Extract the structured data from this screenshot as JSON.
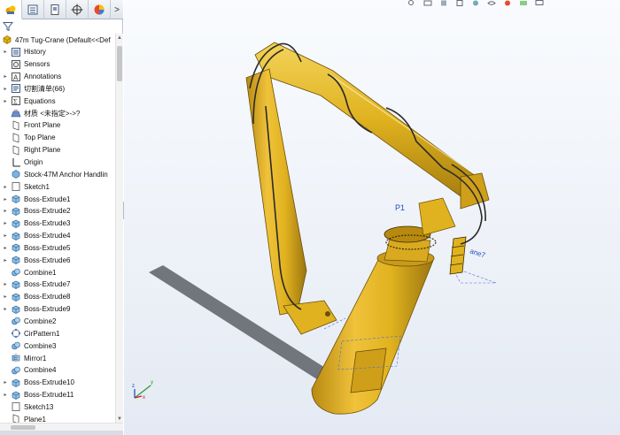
{
  "panel": {
    "tabs": [
      {
        "icon": "feature-manager-icon"
      },
      {
        "icon": "property-manager-icon"
      },
      {
        "icon": "configuration-manager-icon"
      },
      {
        "icon": "dimxpert-icon"
      },
      {
        "icon": "display-manager-icon"
      }
    ],
    "more_tabs": ">",
    "root_label": "47m Tug-Crane  (Default<<Def"
  },
  "tree": [
    {
      "label": "History",
      "icon": "history-icon",
      "expandable": true
    },
    {
      "label": "Sensors",
      "icon": "sensors-icon",
      "expandable": false
    },
    {
      "label": "Annotations",
      "icon": "annotations-icon",
      "expandable": true
    },
    {
      "label": "切割清单(66)",
      "icon": "cut-list-icon",
      "expandable": true
    },
    {
      "label": "Equations",
      "icon": "equations-icon",
      "expandable": true
    },
    {
      "label": "材质 <未指定>->?",
      "icon": "material-icon",
      "expandable": false
    },
    {
      "label": "Front Plane",
      "icon": "plane-icon",
      "expandable": false
    },
    {
      "label": "Top Plane",
      "icon": "plane-icon",
      "expandable": false
    },
    {
      "label": "Right Plane",
      "icon": "plane-icon",
      "expandable": false
    },
    {
      "label": "Origin",
      "icon": "origin-icon",
      "expandable": false
    },
    {
      "label": "Stock-47M Anchor Handlin",
      "icon": "stock-part-icon",
      "expandable": false
    },
    {
      "label": "Sketch1",
      "icon": "sketch-icon",
      "expandable": true
    },
    {
      "label": "Boss-Extrude1",
      "icon": "boss-extrude-icon",
      "expandable": true
    },
    {
      "label": "Boss-Extrude2",
      "icon": "boss-extrude-icon",
      "expandable": true
    },
    {
      "label": "Boss-Extrude3",
      "icon": "boss-extrude-icon",
      "expandable": true
    },
    {
      "label": "Boss-Extrude4",
      "icon": "boss-extrude-icon",
      "expandable": true
    },
    {
      "label": "Boss-Extrude5",
      "icon": "boss-extrude-icon",
      "expandable": true
    },
    {
      "label": "Boss-Extrude6",
      "icon": "boss-extrude-icon",
      "expandable": true
    },
    {
      "label": "Combine1",
      "icon": "combine-icon",
      "expandable": false
    },
    {
      "label": "Boss-Extrude7",
      "icon": "boss-extrude-icon",
      "expandable": true
    },
    {
      "label": "Boss-Extrude8",
      "icon": "boss-extrude-icon",
      "expandable": true
    },
    {
      "label": "Boss-Extrude9",
      "icon": "boss-extrude-icon",
      "expandable": true
    },
    {
      "label": "Combine2",
      "icon": "combine-icon",
      "expandable": false
    },
    {
      "label": "CirPattern1",
      "icon": "circular-pattern-icon",
      "expandable": false
    },
    {
      "label": "Combine3",
      "icon": "combine-icon",
      "expandable": false
    },
    {
      "label": "Mirror1",
      "icon": "mirror-icon",
      "expandable": false
    },
    {
      "label": "Combine4",
      "icon": "combine-icon",
      "expandable": false
    },
    {
      "label": "Boss-Extrude10",
      "icon": "boss-extrude-icon",
      "expandable": true
    },
    {
      "label": "Boss-Extrude11",
      "icon": "boss-extrude-icon",
      "expandable": true
    },
    {
      "label": "Sketch13",
      "icon": "sketch-icon",
      "expandable": false
    },
    {
      "label": "Plane1",
      "icon": "plane-icon",
      "expandable": false
    }
  ],
  "viewport": {
    "annotations": {
      "plane_label_left": "P1",
      "plane_label_right": "ane7"
    },
    "triad": {
      "x": "x",
      "y": "y",
      "z": "z"
    },
    "colors": {
      "model_yellow": "#e0b21f",
      "model_shadow": "#9a7410",
      "model_highlight": "#f3d35a",
      "hose_dark": "#2a2a2a",
      "ground_shadow": "#5c5f66",
      "background_top": "#f9fbfe",
      "background_bottom": "#e4eaf3"
    }
  }
}
